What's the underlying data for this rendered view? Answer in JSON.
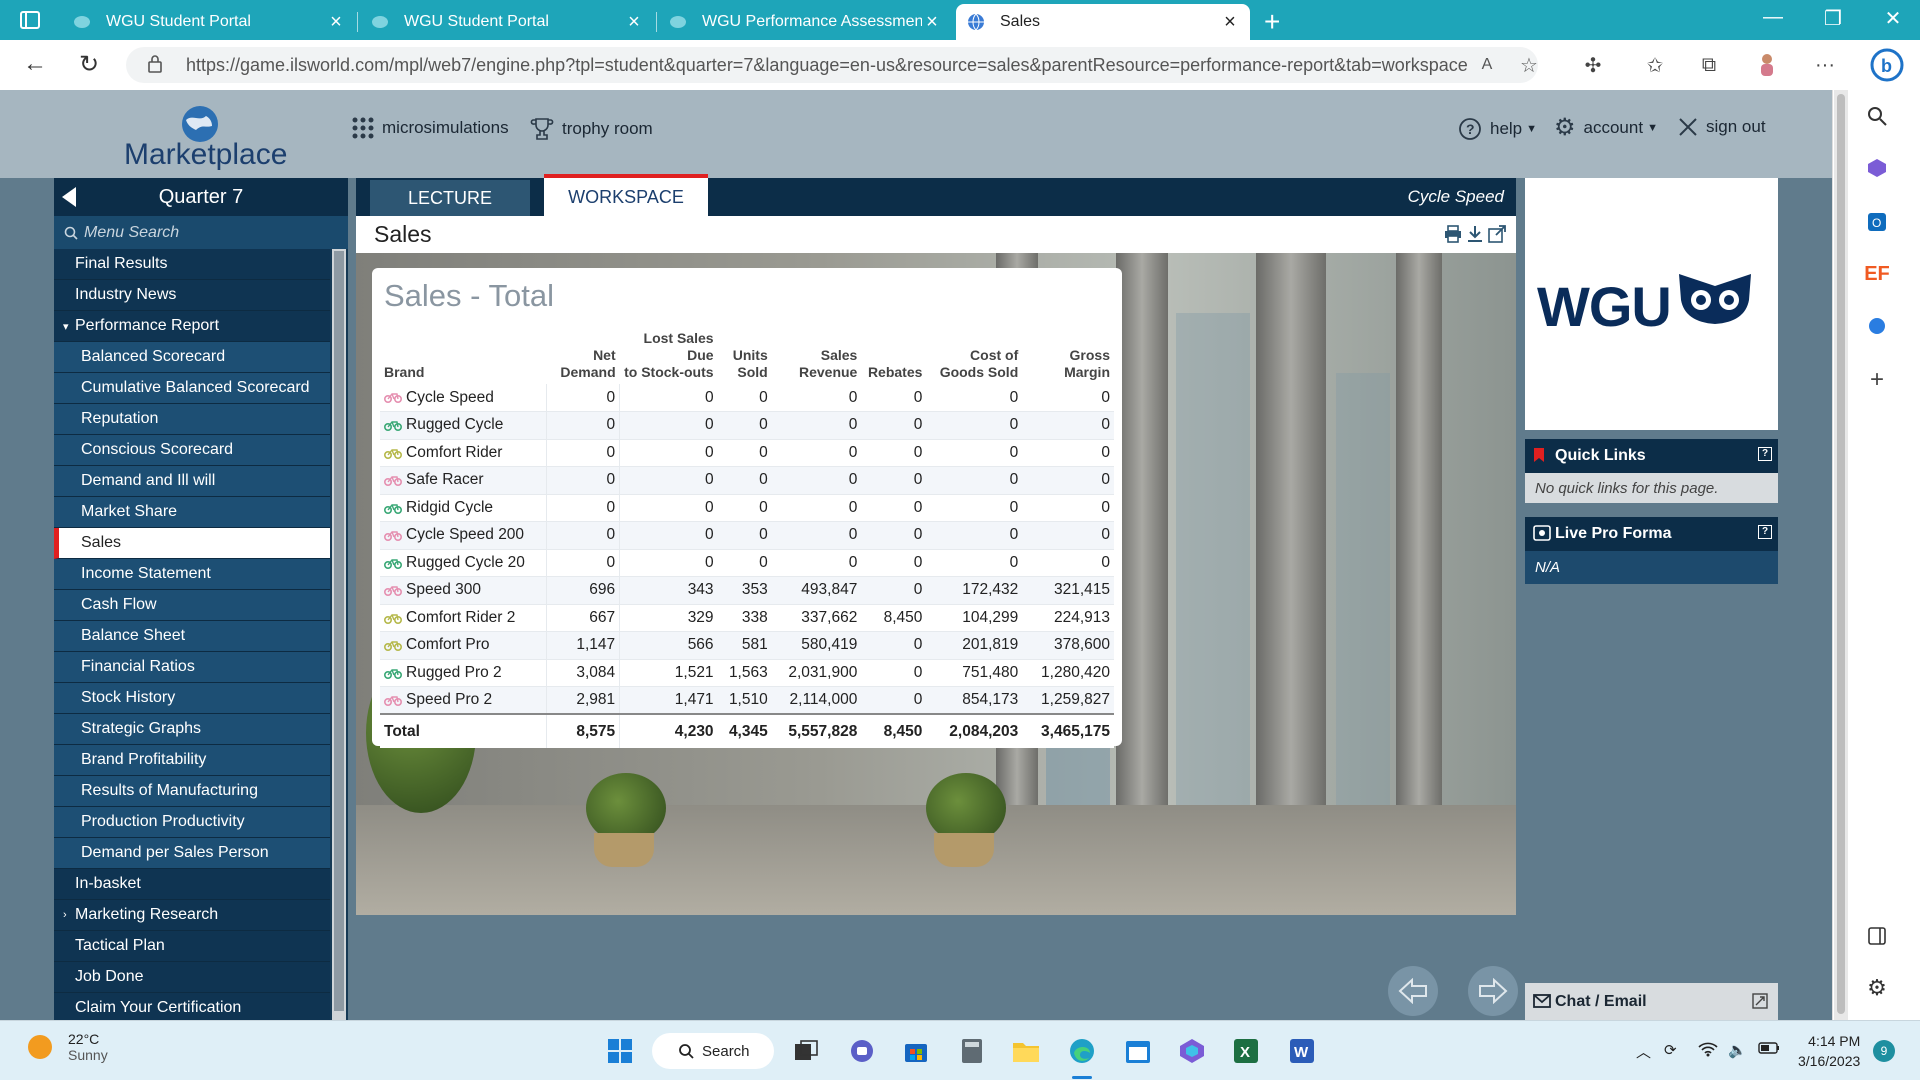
{
  "browser": {
    "tabs": [
      {
        "title": "WGU Student Portal",
        "active": false
      },
      {
        "title": "WGU Student Portal",
        "active": false
      },
      {
        "title": "WGU Performance Assessment",
        "active": false
      },
      {
        "title": "Sales",
        "active": true
      }
    ],
    "url": "https://game.ilsworld.com/mpl/web7/engine.php?tpl=student&quarter=7&language=en-us&resource=sales&parentResource=performance-report&tab=workspace"
  },
  "header": {
    "logo": "Marketplace",
    "links": {
      "microsimulations": "microsimulations",
      "trophy": "trophy room",
      "help": "help",
      "account": "account",
      "signout": "sign out"
    }
  },
  "nav": {
    "quarter": "Quarter 7",
    "search_placeholder": "Menu Search",
    "items": [
      {
        "label": "Final Results",
        "level": 0
      },
      {
        "label": "Industry News",
        "level": 0
      },
      {
        "label": "Performance Report",
        "level": 0,
        "expanded": true
      },
      {
        "label": "Balanced Scorecard",
        "level": 1
      },
      {
        "label": "Cumulative Balanced Scorecard",
        "level": 1
      },
      {
        "label": "Reputation",
        "level": 1
      },
      {
        "label": "Conscious Scorecard",
        "level": 1
      },
      {
        "label": "Demand and Ill will",
        "level": 1
      },
      {
        "label": "Market Share",
        "level": 1
      },
      {
        "label": "Sales",
        "level": 1,
        "active": true
      },
      {
        "label": "Income Statement",
        "level": 1
      },
      {
        "label": "Cash Flow",
        "level": 1
      },
      {
        "label": "Balance Sheet",
        "level": 1
      },
      {
        "label": "Financial Ratios",
        "level": 1
      },
      {
        "label": "Stock History",
        "level": 1
      },
      {
        "label": "Strategic Graphs",
        "level": 1
      },
      {
        "label": "Brand Profitability",
        "level": 1
      },
      {
        "label": "Results of Manufacturing",
        "level": 1
      },
      {
        "label": "Production Productivity",
        "level": 1
      },
      {
        "label": "Demand per Sales Person",
        "level": 1
      },
      {
        "label": "In-basket",
        "level": 0
      },
      {
        "label": "Marketing Research",
        "level": 0,
        "collapsed": true
      },
      {
        "label": "Tactical Plan",
        "level": 0
      },
      {
        "label": "Job Done",
        "level": 0
      },
      {
        "label": "Claim Your Certification",
        "level": 0
      }
    ]
  },
  "content": {
    "tab_lecture": "LECTURE",
    "tab_workspace": "WORKSPACE",
    "brand_label": "Cycle Speed",
    "page_title": "Sales",
    "panel_title": "Sales - Total",
    "table": {
      "headers": [
        "Brand",
        "Net Demand",
        "Lost Sales Due to Stock-outs",
        "Units Sold",
        "Sales Revenue",
        "Rebates",
        "Cost of Goods Sold",
        "Gross Margin"
      ],
      "rows": [
        {
          "brand": "Cycle Speed",
          "icon": "pink",
          "cells": [
            "0",
            "0",
            "0",
            "0",
            "0",
            "0",
            "0"
          ]
        },
        {
          "brand": "Rugged Cycle",
          "icon": "green",
          "cells": [
            "0",
            "0",
            "0",
            "0",
            "0",
            "0",
            "0"
          ]
        },
        {
          "brand": "Comfort Rider",
          "icon": "olive",
          "cells": [
            "0",
            "0",
            "0",
            "0",
            "0",
            "0",
            "0"
          ]
        },
        {
          "brand": "Safe Racer",
          "icon": "pink",
          "cells": [
            "0",
            "0",
            "0",
            "0",
            "0",
            "0",
            "0"
          ]
        },
        {
          "brand": "Ridgid Cycle",
          "icon": "green",
          "cells": [
            "0",
            "0",
            "0",
            "0",
            "0",
            "0",
            "0"
          ]
        },
        {
          "brand": "Cycle Speed 200",
          "icon": "pink",
          "cells": [
            "0",
            "0",
            "0",
            "0",
            "0",
            "0",
            "0"
          ]
        },
        {
          "brand": "Rugged Cycle 20",
          "icon": "green",
          "cells": [
            "0",
            "0",
            "0",
            "0",
            "0",
            "0",
            "0"
          ]
        },
        {
          "brand": "Speed 300",
          "icon": "pink",
          "cells": [
            "696",
            "343",
            "353",
            "493,847",
            "0",
            "172,432",
            "321,415"
          ]
        },
        {
          "brand": "Comfort Rider 2",
          "icon": "olive",
          "cells": [
            "667",
            "329",
            "338",
            "337,662",
            "8,450",
            "104,299",
            "224,913"
          ]
        },
        {
          "brand": "Comfort Pro",
          "icon": "olive",
          "cells": [
            "1,147",
            "566",
            "581",
            "580,419",
            "0",
            "201,819",
            "378,600"
          ]
        },
        {
          "brand": "Rugged Pro 2",
          "icon": "green",
          "cells": [
            "3,084",
            "1,521",
            "1,563",
            "2,031,900",
            "0",
            "751,480",
            "1,280,420"
          ]
        },
        {
          "brand": "Speed Pro 2",
          "icon": "pink",
          "cells": [
            "2,981",
            "1,471",
            "1,510",
            "2,114,000",
            "0",
            "854,173",
            "1,259,827"
          ]
        }
      ],
      "total": {
        "label": "Total",
        "cells": [
          "8,575",
          "4,230",
          "4,345",
          "5,557,828",
          "8,450",
          "2,084,203",
          "3,465,175"
        ]
      }
    }
  },
  "right": {
    "wgu": "WGU",
    "quick_links_title": "Quick Links",
    "quick_links_empty": "No quick links for this page.",
    "live_pro_forma_title": "Live Pro Forma",
    "live_pro_forma_value": "N/A",
    "chat_label": "Chat  / Email"
  },
  "taskbar": {
    "temp": "22°C",
    "weather": "Sunny",
    "search": "Search",
    "time": "4:14 PM",
    "date": "3/16/2023",
    "notifications": "9"
  },
  "colors": {
    "accent_red": "#e02020",
    "nav_dark": "#0c2d48",
    "tab_teal": "#1ea5b9"
  }
}
